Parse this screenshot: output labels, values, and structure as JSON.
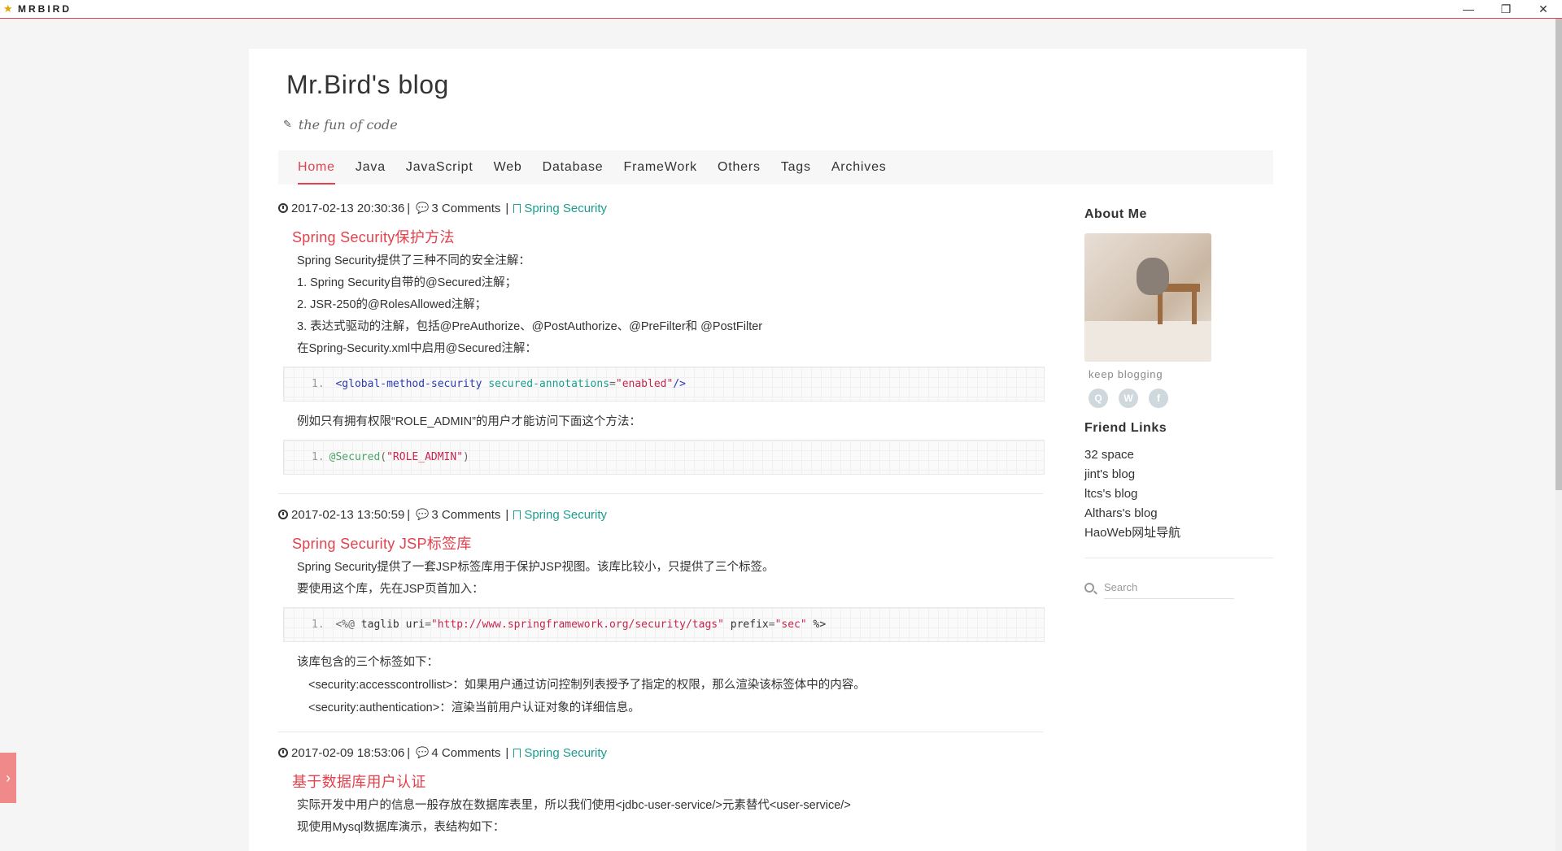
{
  "window": {
    "app_name": "MRBIRD",
    "minimize": "—",
    "restore": "❐",
    "close": "✕"
  },
  "side_toggle": "›",
  "blog": {
    "title": "Mr.Bird's blog",
    "tagline": "the fun of code"
  },
  "nav": [
    "Home",
    "Java",
    "JavaScript",
    "Web",
    "Database",
    "FrameWork",
    "Others",
    "Tags",
    "Archives"
  ],
  "nav_active": "Home",
  "posts": [
    {
      "date": "2017-02-13 20:30:36",
      "sep": "|",
      "comments": "3 Comments",
      "sep2": "|",
      "category": "Spring Security",
      "title": "Spring Security保护方法",
      "lines": [
        "Spring Security提供了三种不同的安全注解：",
        "1. Spring Security自带的@Secured注解；",
        "2. JSR-250的@RolesAllowed注解；",
        "3. 表达式驱动的注解，包括@PreAuthorize、@PostAuthorize、@PreFilter和 @PostFilter",
        "在Spring-Security.xml中启用@Secured注解："
      ],
      "code1": {
        "line_no": "1.",
        "tag_open": "<global-method-security",
        "attr": "secured-annotations",
        "eq": "=",
        "value": "\"enabled\"",
        "tag_close": "/>"
      },
      "middle_line": "例如只有拥有权限“ROLE_ADMIN”的用户才能访问下面这个方法：",
      "code2": {
        "line_no": "1.",
        "anno": "@Secured",
        "open": "(",
        "value": "\"ROLE_ADMIN\"",
        "close": ")"
      }
    },
    {
      "date": "2017-02-13 13:50:59",
      "sep": "|",
      "comments": "3 Comments",
      "sep2": "|",
      "category": "Spring Security",
      "title": "Spring Security JSP标签库",
      "lines": [
        "Spring Security提供了一套JSP标签库用于保护JSP视图。该库比较小，只提供了三个标签。",
        "要使用这个库，先在JSP页首加入："
      ],
      "code": {
        "line_no": "1.",
        "open": "<%@",
        "directive": "taglib",
        "attr1": "uri",
        "eq": "=",
        "val1": "\"http://www.springframework.org/security/tags\"",
        "attr2": "prefix",
        "val2": "\"sec\"",
        "close": "%>"
      },
      "after_line": "该库包含的三个标签如下：",
      "indent_lines": [
        "<security:accesscontrollist>：如果用户通过访问控制列表授予了指定的权限，那么渲染该标签体中的内容。",
        "<security:authentication>：渲染当前用户认证对象的详细信息。"
      ]
    },
    {
      "date": "2017-02-09 18:53:06",
      "sep": "|",
      "comments": "4 Comments",
      "sep2": "|",
      "category": "Spring Security",
      "title": "基于数据库用户认证",
      "lines": [
        "实际开发中用户的信息一般存放在数据库表里，所以我们使用<jdbc-user-service/>元素替代<user-service/>",
        "现使用Mysql数据库演示，表结构如下："
      ]
    }
  ],
  "sidebar": {
    "about_heading": "About Me",
    "keep": "keep blogging",
    "social": [
      "qq-icon",
      "weibo-icon",
      "facebook-icon"
    ],
    "social_glyphs": [
      "Q",
      "W",
      "f"
    ],
    "friend_heading": "Friend Links",
    "friends": [
      "32 space",
      "jint's blog",
      "ltcs's blog",
      "Althars's blog",
      "HaoWeb网址导航"
    ],
    "search_placeholder": "Search"
  }
}
